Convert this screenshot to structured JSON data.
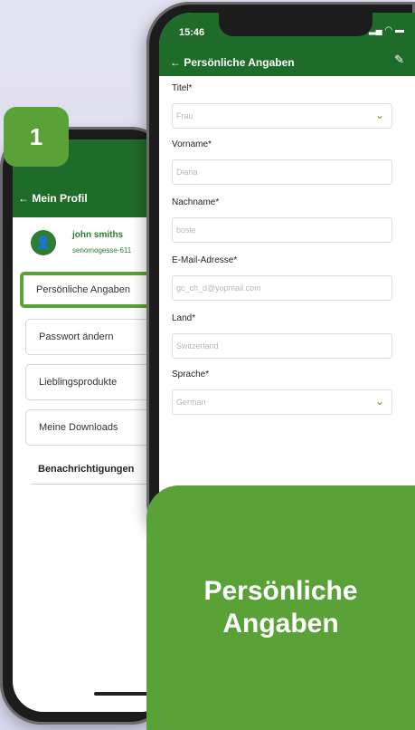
{
  "step": {
    "number": "1"
  },
  "profile_screen": {
    "title": "← Mein Profil",
    "user": {
      "name": "john smiths",
      "username": "senomogesse-611"
    },
    "menu": [
      {
        "label": "Persönliche Angaben",
        "active": true
      },
      {
        "label": "Passwort ändern",
        "active": false
      },
      {
        "label": "Lieblingsprodukte",
        "active": false
      },
      {
        "label": "Meine Downloads",
        "active": false
      }
    ],
    "notifications_label": "Benachrichtigungen"
  },
  "details_screen": {
    "status_time": "15:46",
    "title": "← Persönliche Angaben",
    "fields": [
      {
        "label": "Titel*",
        "value": "Frau",
        "type": "select"
      },
      {
        "label": "Vorname*",
        "value": "Diana",
        "type": "text"
      },
      {
        "label": "Nachname*",
        "value": "bosle",
        "type": "text"
      },
      {
        "label": "E-Mail-Adresse*",
        "value": "gc_ch_d@yopmail.com",
        "type": "text"
      },
      {
        "label": "Land*",
        "value": "Switzerland",
        "type": "text"
      },
      {
        "label": "Sprache*",
        "value": "German",
        "type": "select"
      }
    ]
  },
  "caption": {
    "line1": "Persönliche",
    "line2": "Angaben"
  },
  "colors": {
    "brand_green": "#1f6b2a",
    "accent_green": "#5aa238"
  },
  "icons": {
    "avatar": "user-icon",
    "edit": "pencil-icon",
    "select": "chevron-down-icon"
  }
}
